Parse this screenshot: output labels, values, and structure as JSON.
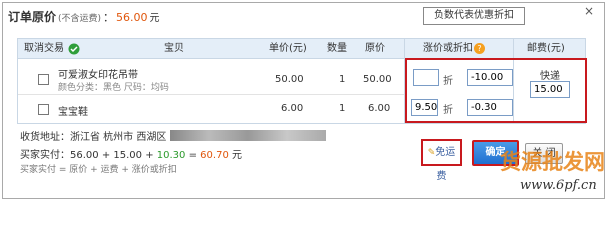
{
  "header": {
    "title": "订单原价",
    "title_note": "(不含运费)",
    "separator": "：",
    "price": "56.00",
    "unit": "元"
  },
  "tooltip": {
    "text": "负数代表优惠折扣"
  },
  "close_x": "×",
  "table": {
    "headers": {
      "cancel": "取消交易",
      "item": "宝贝",
      "unit_price": "单价(元)",
      "quantity": "数量",
      "orig_price": "原价",
      "adjust": "涨价或折扣",
      "help_icon": "?",
      "shipping": "邮费(元)"
    },
    "rows": [
      {
        "name": "可爱淑女印花吊带",
        "spec": "颜色分类：黑色  尺码：均码",
        "unit_price": "50.00",
        "quantity": "1",
        "orig_price": "50.00",
        "discount_value": "",
        "zhe": "折",
        "adjust_value": "-10.00"
      },
      {
        "name": "宝宝鞋",
        "spec": "",
        "unit_price": "6.00",
        "quantity": "1",
        "orig_price": "6.00",
        "discount_value": "9.50",
        "zhe": "折",
        "adjust_value": "-0.30"
      }
    ],
    "shipping_method": "快递",
    "shipping_fee": "15.00"
  },
  "address": {
    "label": "收货地址：",
    "value": "浙江省  杭州市  西湖区"
  },
  "payment": {
    "label": "买家实付：",
    "base": "56.00",
    "plus1": " + ",
    "shipping": "15.00",
    "plus2": " + ",
    "adjust": "10.30",
    "equals": " = ",
    "total": "60.70",
    "unit": " 元"
  },
  "formula": {
    "text": "买家实付 = 原价 + 运费 + 涨价或折扣"
  },
  "actions": {
    "free_shipping": "免运费",
    "confirm": "确定",
    "close": "关 闭"
  },
  "watermark": {
    "brand": "货源批发网",
    "url": "www.6pf.cn"
  },
  "colors": {
    "accent_red": "#c8191e",
    "price_orange": "#e0560c",
    "header_blue": "#e4eef8"
  }
}
